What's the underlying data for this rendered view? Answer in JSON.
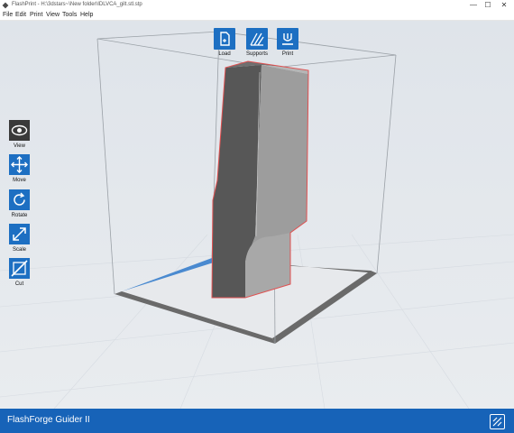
{
  "window": {
    "title": "FlashPrint - H:\\3dstars~\\New folder\\IDLVCA_gilt.stl.stp",
    "minimize": "—",
    "maximize": "☐",
    "close": "✕"
  },
  "menu": [
    "File",
    "Edit",
    "Print",
    "View",
    "Tools",
    "Help"
  ],
  "toolbar": {
    "load": "Load",
    "supports": "Supports",
    "print": "Print"
  },
  "sidebar": {
    "view": "View",
    "move": "Move",
    "rotate": "Rotate",
    "scale": "Scale",
    "cut": "Cut"
  },
  "status": {
    "printer": "FlashForge Guider II"
  },
  "colors": {
    "accent": "#1d6fc2",
    "active_tool": "#3a3a3a",
    "status_bar": "#1763b8",
    "model_outline": "#e05050"
  }
}
